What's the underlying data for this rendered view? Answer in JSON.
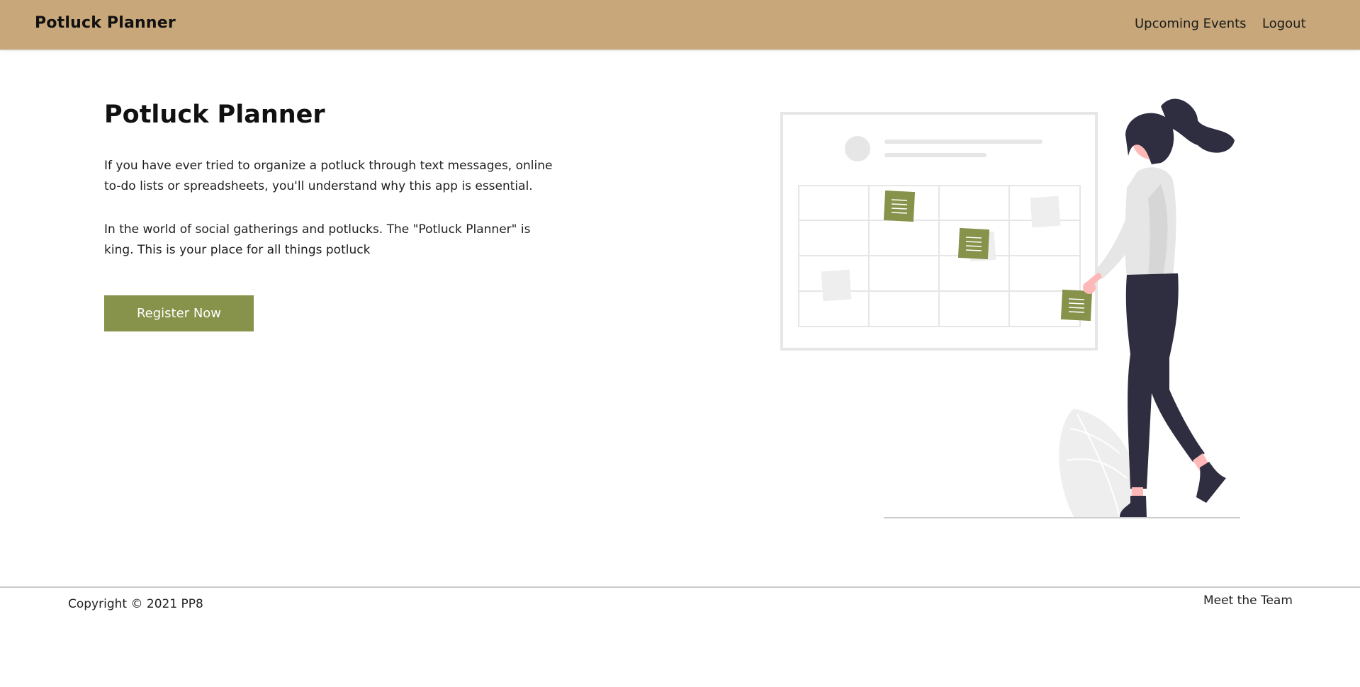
{
  "header": {
    "brand": "Potluck Planner",
    "nav": {
      "upcoming_events": "Upcoming Events",
      "logout": "Logout"
    }
  },
  "hero": {
    "title": "Potluck Planner",
    "paragraph_1": "If you have ever tried to organize a potluck through text messages, online to-do lists or spreadsheets, you'll understand why this app is essential.",
    "paragraph_2": "In the world of social gatherings and potlucks. The \"Potluck Planner\" is king. This is your place for all things potluck",
    "register_button": "Register Now"
  },
  "footer": {
    "copyright": "Copyright © 2021 PP8",
    "meet_team": "Meet the Team"
  },
  "colors": {
    "header_bg": "#c8a87a",
    "accent_green": "#87924a",
    "figure_dark": "#2f2e41",
    "skin": "#ffb8b8",
    "light_gray": "#e6e6e6"
  }
}
